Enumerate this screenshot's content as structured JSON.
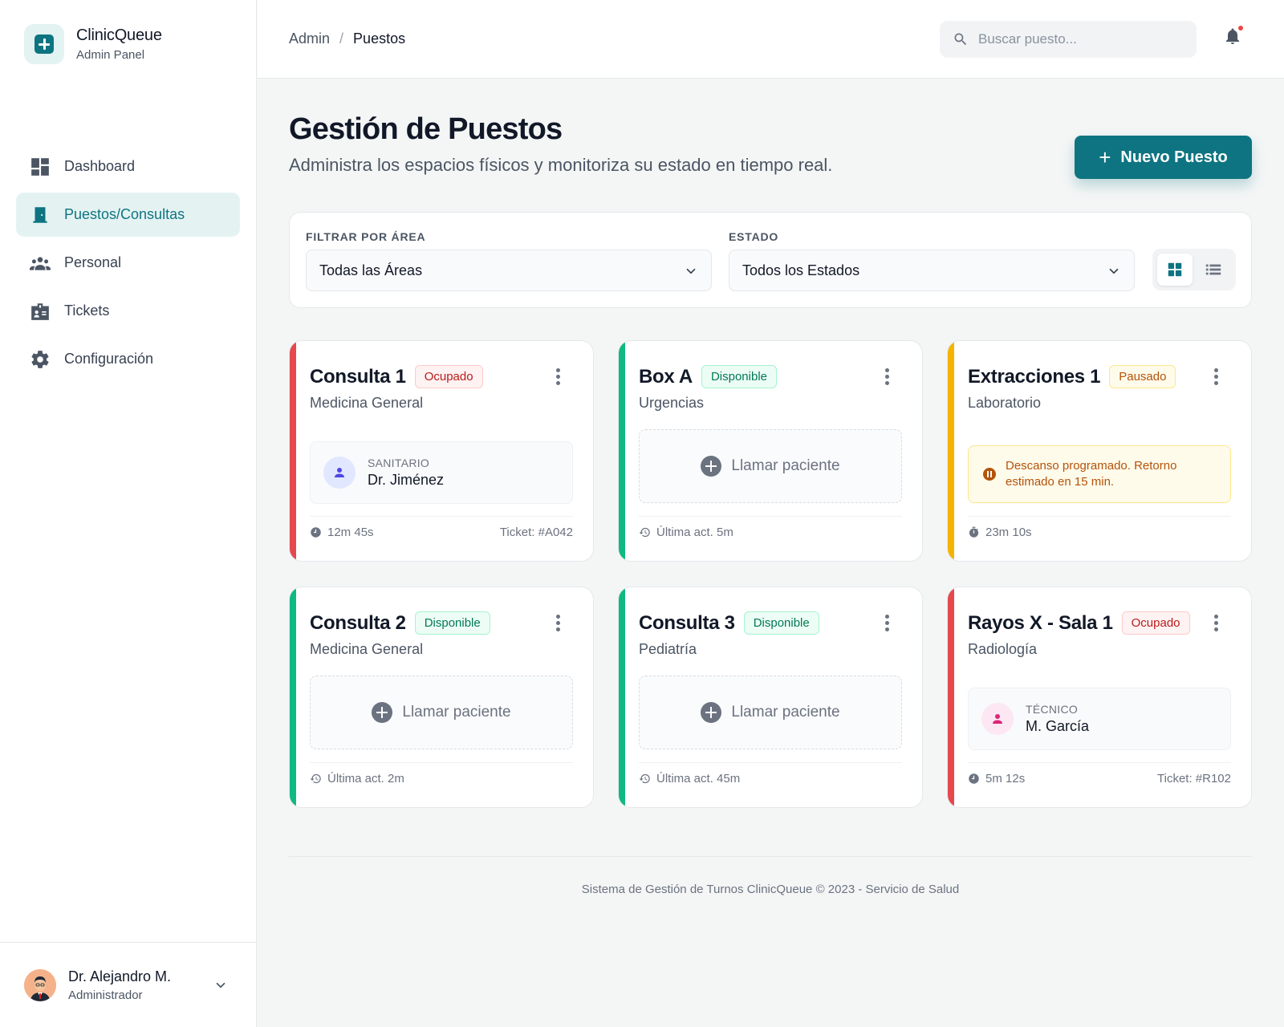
{
  "brand": {
    "name": "ClinicQueue",
    "subtitle": "Admin Panel"
  },
  "sidebar": {
    "items": [
      {
        "label": "Dashboard",
        "icon": "dashboard-icon",
        "active": false
      },
      {
        "label": "Puestos/Consultas",
        "icon": "door-icon",
        "active": true
      },
      {
        "label": "Personal",
        "icon": "people-icon",
        "active": false
      },
      {
        "label": "Tickets",
        "icon": "badge-icon",
        "active": false
      },
      {
        "label": "Configuración",
        "icon": "gear-icon",
        "active": false
      }
    ]
  },
  "user": {
    "name": "Dr. Alejandro M.",
    "role": "Administrador"
  },
  "header": {
    "breadcrumb": [
      "Admin",
      "Puestos"
    ],
    "search_placeholder": "Buscar puesto..."
  },
  "page": {
    "title": "Gestión de Puestos",
    "subtitle": "Administra los espacios físicos y monitoriza su estado en tiempo real.",
    "new_button": "Nuevo Puesto"
  },
  "filters": {
    "area_label": "FILTRAR POR ÁREA",
    "area_value": "Todas las Áreas",
    "status_label": "ESTADO",
    "status_value": "Todos los Estados"
  },
  "cards": [
    {
      "name": "Consulta 1",
      "status": "Ocupado",
      "area": "Medicina General",
      "person_role": "SANITARIO",
      "person_name": "Dr. Jiménez",
      "footer_left": "12m 45s",
      "footer_right": "Ticket: #A042"
    },
    {
      "name": "Box A",
      "status": "Disponible",
      "area": "Urgencias",
      "call_label": "Llamar paciente",
      "footer_left": "Última act. 5m"
    },
    {
      "name": "Extracciones 1",
      "status": "Pausado",
      "area": "Laboratorio",
      "notice": "Descanso programado. Retorno estimado en 15 min.",
      "footer_left": "23m 10s"
    },
    {
      "name": "Consulta 2",
      "status": "Disponible",
      "area": "Medicina General",
      "call_label": "Llamar paciente",
      "footer_left": "Última act. 2m"
    },
    {
      "name": "Consulta 3",
      "status": "Disponible",
      "area": "Pediatría",
      "call_label": "Llamar paciente",
      "footer_left": "Última act. 45m"
    },
    {
      "name": "Rayos X - Sala 1",
      "status": "Ocupado",
      "area": "Radiología",
      "person_role": "TÉCNICO",
      "person_name": "M. García",
      "footer_left": "5m 12s",
      "footer_right": "Ticket: #R102"
    }
  ],
  "colors": {
    "accent": "#0e7481",
    "ocupado": "#e5484d",
    "disponible": "#10b981",
    "pausado": "#f5b300"
  },
  "footer": {
    "text": "Sistema de Gestión de Turnos ClinicQueue © 2023 - Servicio de Salud"
  }
}
